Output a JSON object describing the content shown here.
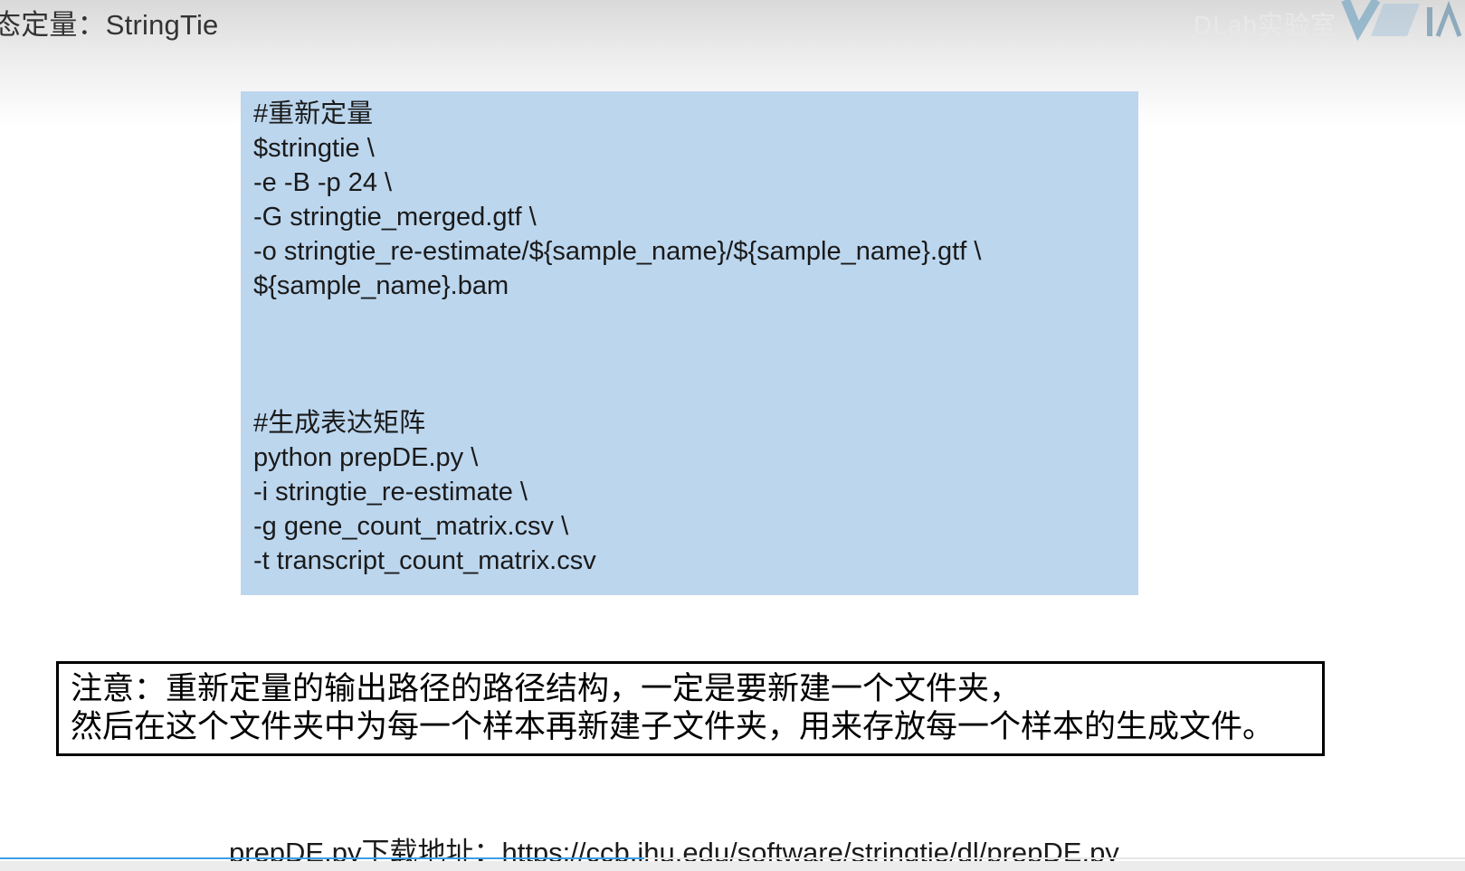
{
  "slide": {
    "title": "态定量：StringTie"
  },
  "watermark": {
    "text": "DLab实验室"
  },
  "code_box": {
    "block1": [
      "#重新定量",
      "$stringtie \\",
      "-e -B -p 24 \\",
      "-G stringtie_merged.gtf \\",
      "-o stringtie_re-estimate/${sample_name}/${sample_name}.gtf \\",
      "${sample_name}.bam"
    ],
    "block2": [
      "#生成表达矩阵",
      "python prepDE.py \\",
      "-i stringtie_re-estimate \\",
      "-g gene_count_matrix.csv \\",
      "-t transcript_count_matrix.csv"
    ]
  },
  "note": {
    "line1": "注意：重新定量的输出路径的路径结构，一定是要新建一个文件夹，",
    "line2": "然后在这个文件夹中为每一个样本再新建子文件夹，用来存放每一个样本的生成文件。"
  },
  "download": {
    "text": "prepDE.py下载地址：https://ccb.jhu.edu/software/stringtie/dl/prepDE.py"
  },
  "video_progress": {
    "fraction": 0.44
  },
  "colors": {
    "code_background": "#bcd6ee",
    "progress_accent": "#3aa0e8",
    "note_border": "#000000"
  }
}
